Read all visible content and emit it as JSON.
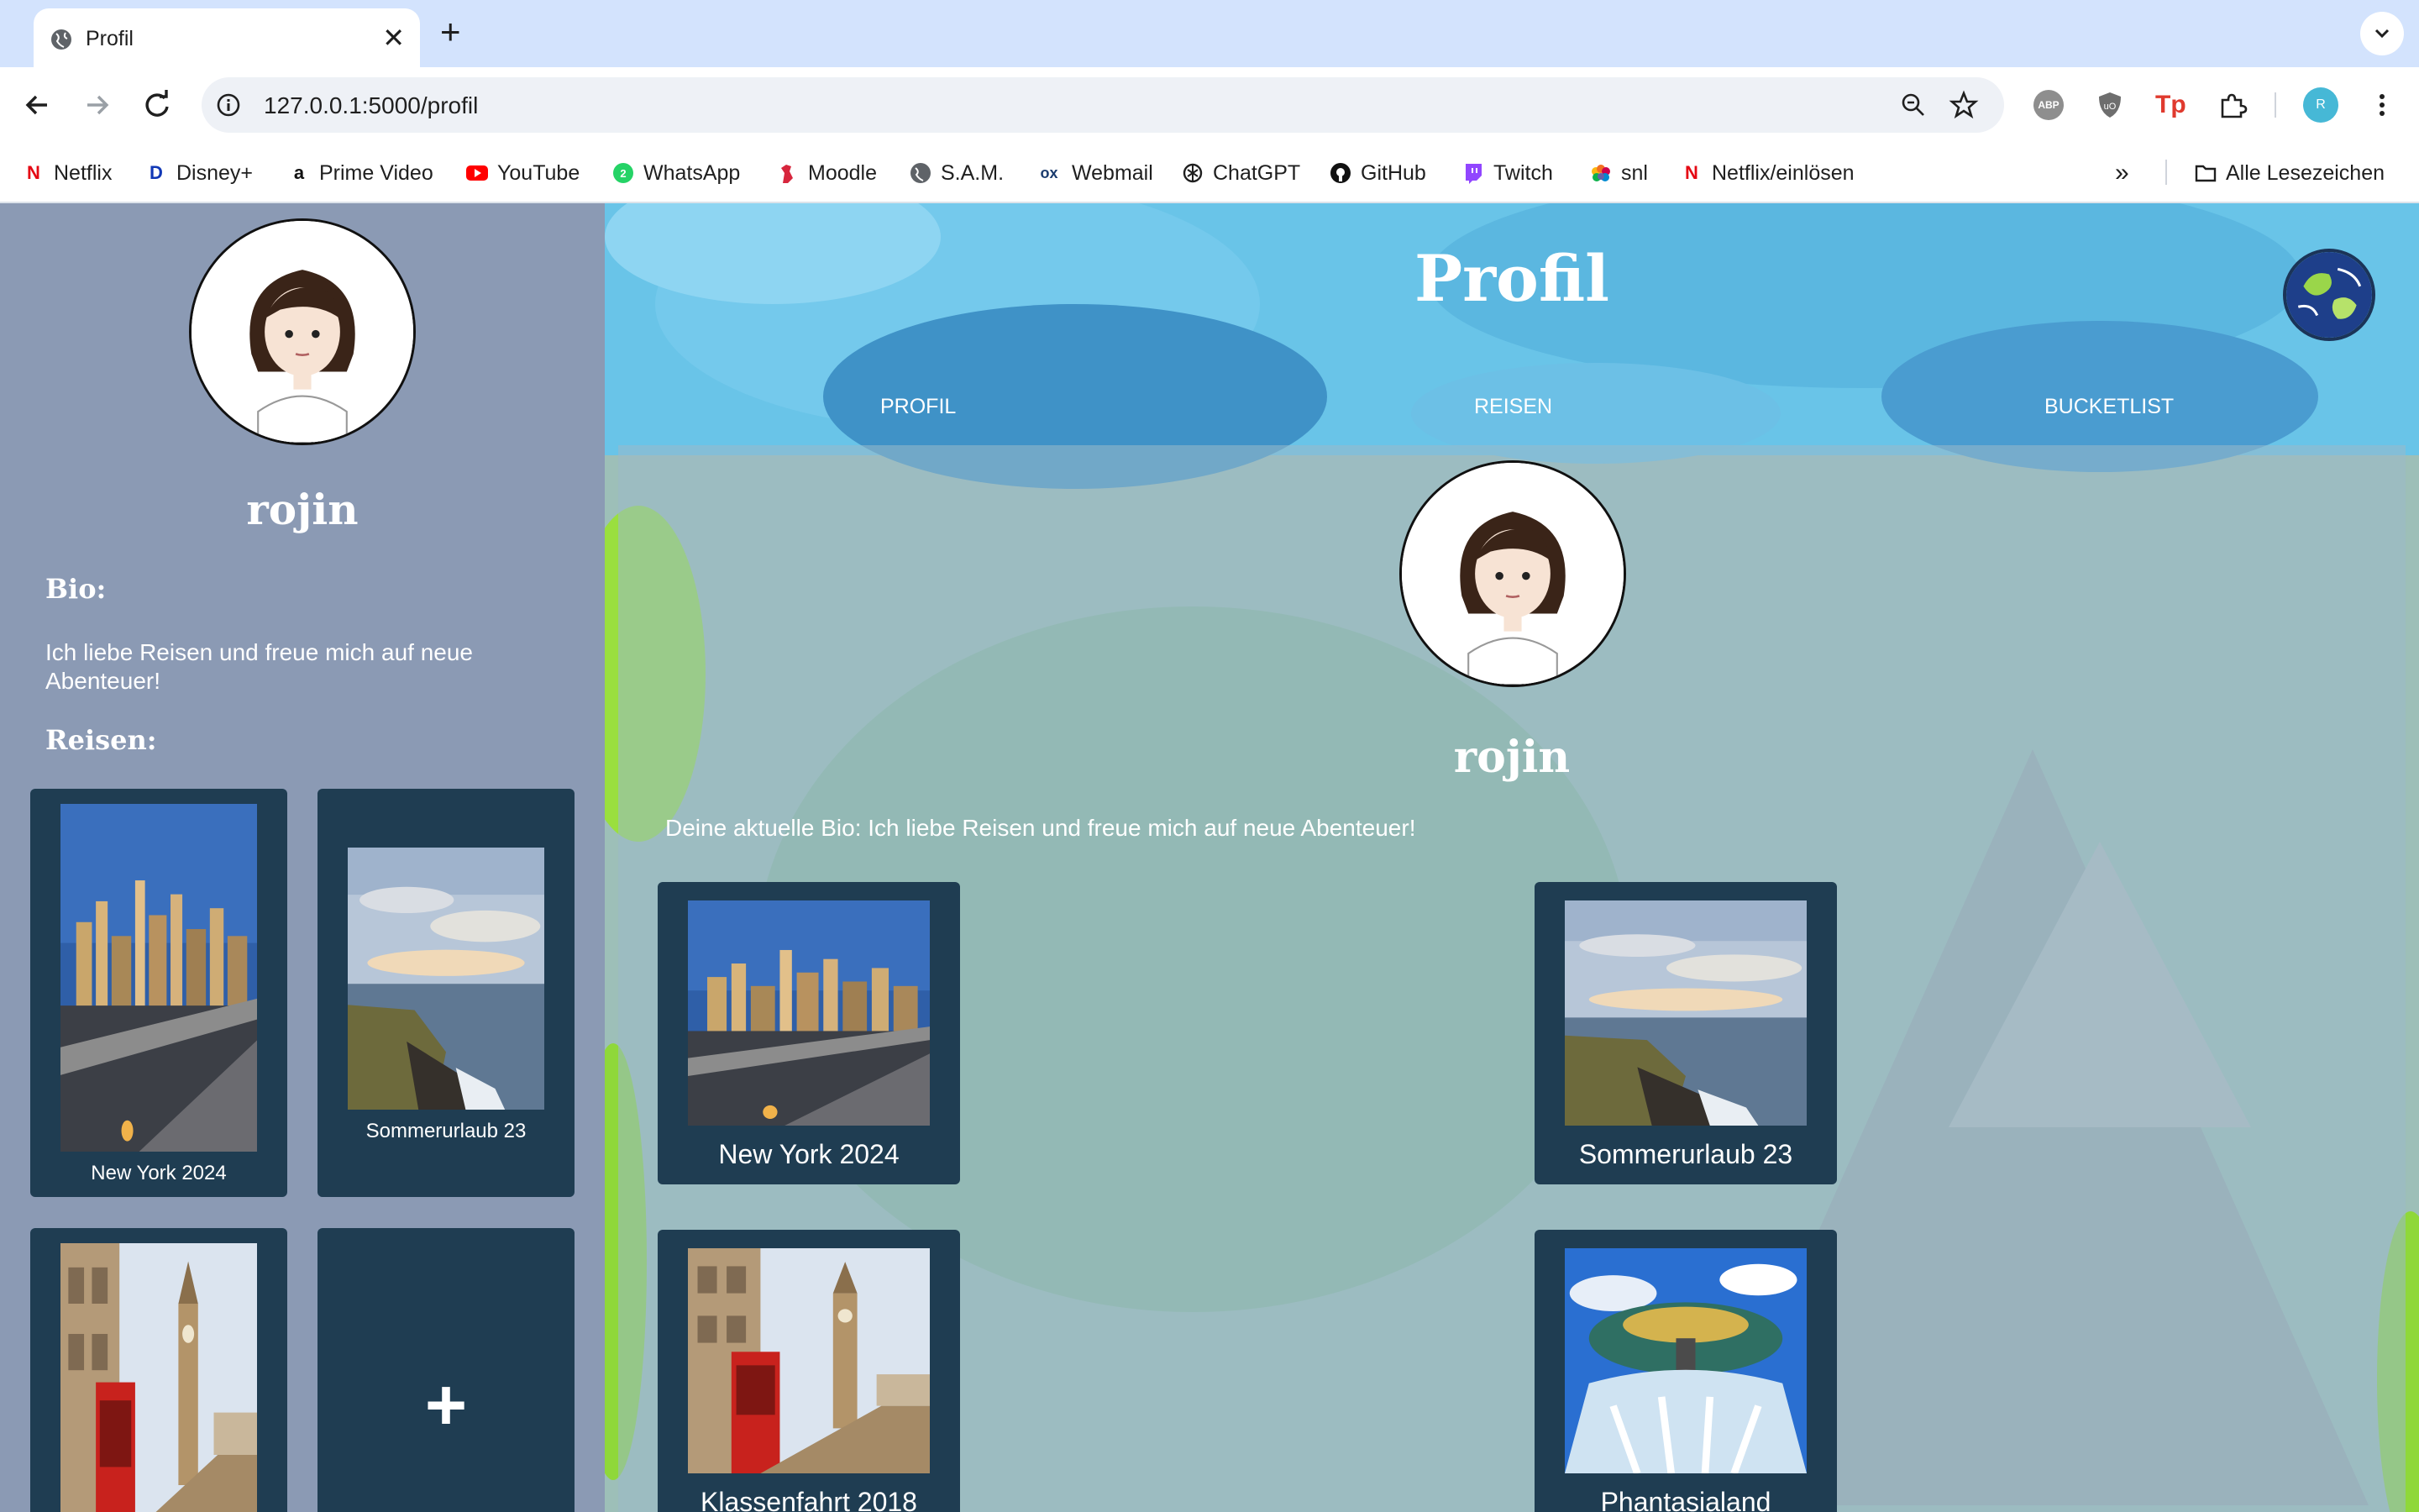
{
  "browser": {
    "tab_title": "Profil",
    "url": "127.0.0.1:5000/profil",
    "profile_initial": "R",
    "extensions": {
      "abp": "ABP",
      "tp": "Tp"
    },
    "bookmarks": [
      "Netflix",
      "Disney+",
      "Prime Video",
      "YouTube",
      "WhatsApp",
      "Moodle",
      "S.A.M.",
      "Webmail",
      "ChatGPT",
      "GitHub",
      "Twitch",
      "snl",
      "Netflix/einlösen"
    ],
    "bookmarks_overflow": "»",
    "all_bookmarks": "Alle Lesezeichen"
  },
  "sidebar": {
    "username": "rojin",
    "bio_heading": "Bio:",
    "bio_text": "Ich liebe Reisen und freue mich auf neue Abenteuer!",
    "trips_heading": "Reisen:",
    "trips": [
      {
        "name": "New York 2024"
      },
      {
        "name": "Sommerurlaub 23"
      },
      {
        "name": "Klassenfahrt 2018"
      }
    ],
    "add_label": "+"
  },
  "main": {
    "title": "Profil",
    "nav": {
      "profil": "PROFIL",
      "reisen": "REISEN",
      "bucketlist": "BUCKETLIST"
    },
    "username": "rojin",
    "bio_line": "Deine aktuelle Bio: Ich liebe Reisen und freue mich auf neue Abenteuer!",
    "trips": [
      {
        "name": "New York 2024"
      },
      {
        "name": "Sommerurlaub 23"
      },
      {
        "name": "Klassenfahrt 2018"
      },
      {
        "name": "Phantasialand"
      }
    ]
  },
  "colors": {
    "sidebar_bg": "#8b9ab4",
    "card_bg": "#1f3d52",
    "tab_strip": "#d3e3fd"
  }
}
